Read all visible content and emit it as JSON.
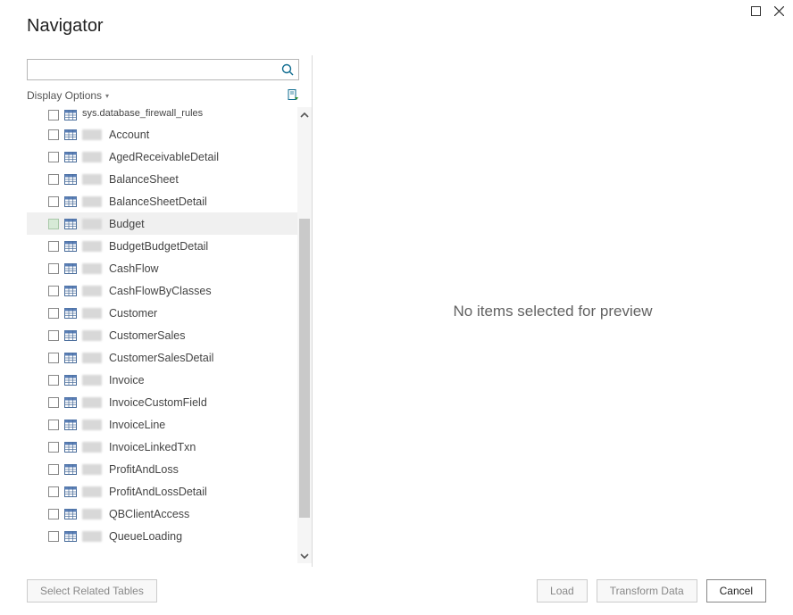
{
  "title": "Navigator",
  "search": {
    "placeholder": ""
  },
  "displayOptions": {
    "label": "Display Options"
  },
  "tree": {
    "items": [
      {
        "label": "sys.database_firewall_rules",
        "prefixBlur": false,
        "treeNode": true
      },
      {
        "label": "Account",
        "prefixBlur": true
      },
      {
        "label": "AgedReceivableDetail",
        "prefixBlur": true
      },
      {
        "label": "BalanceSheet",
        "prefixBlur": true
      },
      {
        "label": "BalanceSheetDetail",
        "prefixBlur": true
      },
      {
        "label": "Budget",
        "prefixBlur": true,
        "highlight": true
      },
      {
        "label": "BudgetBudgetDetail",
        "prefixBlur": true
      },
      {
        "label": "CashFlow",
        "prefixBlur": true
      },
      {
        "label": "CashFlowByClasses",
        "prefixBlur": true
      },
      {
        "label": "Customer",
        "prefixBlur": true
      },
      {
        "label": "CustomerSales",
        "prefixBlur": true
      },
      {
        "label": "CustomerSalesDetail",
        "prefixBlur": true
      },
      {
        "label": "Invoice",
        "prefixBlur": true
      },
      {
        "label": "InvoiceCustomField",
        "prefixBlur": true
      },
      {
        "label": "InvoiceLine",
        "prefixBlur": true
      },
      {
        "label": "InvoiceLinkedTxn",
        "prefixBlur": true
      },
      {
        "label": "ProfitAndLoss",
        "prefixBlur": true
      },
      {
        "label": "ProfitAndLossDetail",
        "prefixBlur": true
      },
      {
        "label": "QBClientAccess",
        "prefixBlur": true
      },
      {
        "label": "QueueLoading",
        "prefixBlur": true
      }
    ]
  },
  "preview": {
    "empty_message": "No items selected for preview"
  },
  "footer": {
    "select_related": "Select Related Tables",
    "load": "Load",
    "transform": "Transform Data",
    "cancel": "Cancel"
  }
}
